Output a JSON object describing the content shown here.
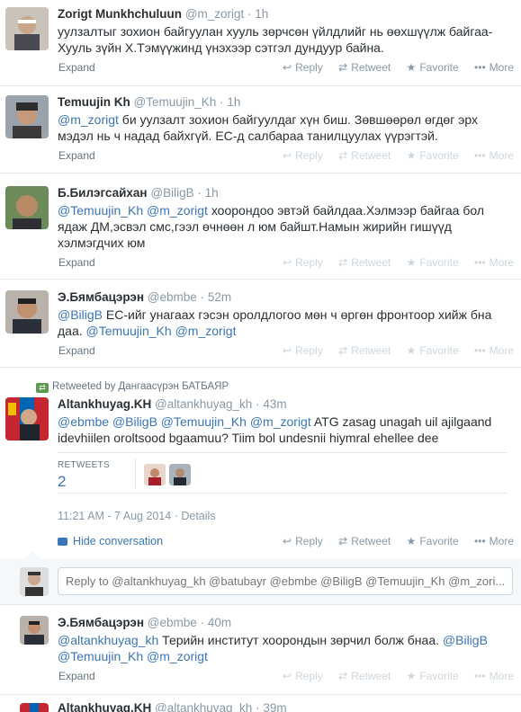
{
  "actions": {
    "reply": "Reply",
    "retweet": "Retweet",
    "favorite": "Favorite",
    "more": "More",
    "expand": "Expand"
  },
  "icons": {
    "reply": "reply-arrow-icon",
    "retweet": "retweet-icon",
    "favorite": "star-icon",
    "more": "more-dots-icon"
  },
  "tweets": [
    {
      "fullname": "Zorigt Munkhchuluun",
      "username": "@m_zorigt",
      "sep": "·",
      "time": "1h",
      "text": "уулзалтыг зохион байгуулан хууль зөрчсөн үйлдлийг нь өөхшүүлж байгаа- Хууль зүйн Х.Тэмүүжинд үнэхээр сэтгэл дундуур байна."
    },
    {
      "fullname": "Temuujin Kh",
      "username": "@Temuujin_Kh",
      "sep": "·",
      "time": "1h",
      "mention": "@m_zorigt",
      "text": " би уулзалт зохион байгуулдаг хүн биш. Зөвшөөрөл өгдөг эрх мэдэл нь ч надад байхгүй. ЕС-д салбараа танилцуулах үүрэгтэй."
    },
    {
      "fullname": "Б.Билэгсайхан",
      "username": "@BiligB",
      "sep": "·",
      "time": "1h",
      "mention1": "@Temuujin_Kh",
      "mention2": "@m_zorigt",
      "text": " хоорондоо эвтэй байлдаа.Хэлмээр байгаа бол ядаж ДМ,эсвэл смс,гээл өчнөөн л юм байшт.Намын жирийн гишүүд хэлмэгдчих юм"
    },
    {
      "fullname": "Э.Бямбацэрэн",
      "username": "@ebmbe",
      "sep": "·",
      "time": "52m",
      "mention1": "@BiligB",
      "mention2": "@Temuujin_Kh",
      "mention3": "@m_zorigt",
      "text": " ЕС-ийг унагаах гэсэн оролдлогоо мөн ч өргөн фронтоор хийж бна даа."
    },
    {
      "retweeted_by": "Retweeted by Дангаасүрэн БАТБАЯР",
      "fullname": "Altankhuyag.KH",
      "username": "@altankhuyag_kh",
      "sep": "·",
      "time": "43m",
      "mentions": "@ebmbe @BiligB @Temuujin_Kh @m_zorigt",
      "text": " ATG zasag unagah uil ajilgaand idevhiilen oroltsood bgaamuu? Tiim bol undesnii hiymral ehellee dee",
      "stats_label": "RETWEETS",
      "stats_value": "2",
      "detail_time": "11:21 AM - 7 Aug 2014 · Details",
      "hide_conversation": "Hide conversation"
    },
    {
      "fullname": "Э.Бямбацэрэн",
      "username": "@ebmbe",
      "sep": "·",
      "time": "40m",
      "mention1": "@altankhuyag_kh",
      "text1": " Терийн институт хоорондын зөрчил болж бнаа.",
      "mention2": "@BiligB",
      "mention3": "@Temuujin_Kh",
      "mention4": "@m_zorigt"
    },
    {
      "fullname": "Altankhuyag.KH",
      "username": "@altankhuyag_kh",
      "sep": "·",
      "time": "39m"
    }
  ],
  "reply_box": {
    "placeholder": "Reply to @altankhuyag_kh @batubayr @ebmbe @BiligB @Temuujin_Kh @m_zori..."
  },
  "colors": {
    "link": "#3a76b7",
    "muted": "#8899a6",
    "border": "#e1e8ed",
    "retweet_green": "#5a9a4e"
  }
}
